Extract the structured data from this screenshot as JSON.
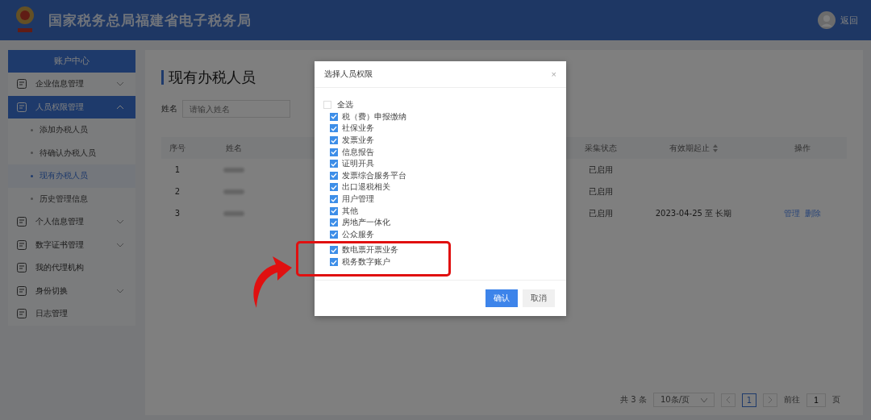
{
  "header": {
    "title": "国家税务总局福建省电子税务局",
    "user_link": "返回"
  },
  "sidebar": {
    "title": "账户中心",
    "items": [
      {
        "label": "企业信息管理",
        "expanded": false,
        "selected": false
      },
      {
        "label": "人员权限管理",
        "expanded": true,
        "selected": true,
        "children": [
          {
            "label": "添加办税人员",
            "selected": false
          },
          {
            "label": "待确认办税人员",
            "selected": false
          },
          {
            "label": "现有办税人员",
            "selected": true
          },
          {
            "label": "历史管理信息",
            "selected": false
          }
        ]
      },
      {
        "label": "个人信息管理",
        "expanded": false,
        "selected": false
      },
      {
        "label": "数字证书管理",
        "expanded": false,
        "selected": false
      },
      {
        "label": "我的代理机构",
        "selected": false
      },
      {
        "label": "身份切换",
        "expanded": false,
        "selected": false
      },
      {
        "label": "日志管理",
        "selected": false
      }
    ]
  },
  "main": {
    "title": "现有办税人员",
    "filter_label": "姓名",
    "filter_placeholder": "请输入姓名",
    "table": {
      "columns": [
        "序号",
        "姓名",
        "采集状态",
        "有效期起止",
        "操作"
      ],
      "rows": [
        {
          "index": "1",
          "status": "已启用"
        },
        {
          "index": "2",
          "status": "已启用"
        },
        {
          "index": "3",
          "status": "已启用",
          "validity": "2023-04-25 至 长期",
          "actions": [
            "管理",
            "删除"
          ]
        }
      ]
    },
    "pagination": {
      "total": "共 3 条",
      "page_size": "10条/页",
      "pages": [
        {
          "label": "1",
          "selected": true
        }
      ],
      "goto_label": "前往",
      "goto_value": "1",
      "goto_suffix": "页"
    }
  },
  "dialog": {
    "title": "选择人员权限",
    "close": "×",
    "select_all": {
      "label": "全选",
      "checked": false
    },
    "options": [
      {
        "label": "税（费）申报缴纳",
        "checked": true,
        "highlighted": false
      },
      {
        "label": "社保业务",
        "checked": true,
        "highlighted": false
      },
      {
        "label": "发票业务",
        "checked": true,
        "highlighted": false
      },
      {
        "label": "信息报告",
        "checked": true,
        "highlighted": false
      },
      {
        "label": "证明开具",
        "checked": true,
        "highlighted": false
      },
      {
        "label": "发票综合服务平台",
        "checked": true,
        "highlighted": false
      },
      {
        "label": "出口退税相关",
        "checked": true,
        "highlighted": false
      },
      {
        "label": "用户管理",
        "checked": true,
        "highlighted": false
      },
      {
        "label": "其他",
        "checked": true,
        "highlighted": false
      },
      {
        "label": "房地产一体化",
        "checked": true,
        "highlighted": false
      },
      {
        "label": "公众服务",
        "checked": true,
        "highlighted": false
      },
      {
        "label": "数电票开票业务",
        "checked": true,
        "highlighted": true
      },
      {
        "label": "税务数字账户",
        "checked": true,
        "highlighted": true
      }
    ],
    "buttons": [
      {
        "label": "确认",
        "kind": "primary"
      },
      {
        "label": "取消",
        "kind": "default"
      }
    ]
  }
}
